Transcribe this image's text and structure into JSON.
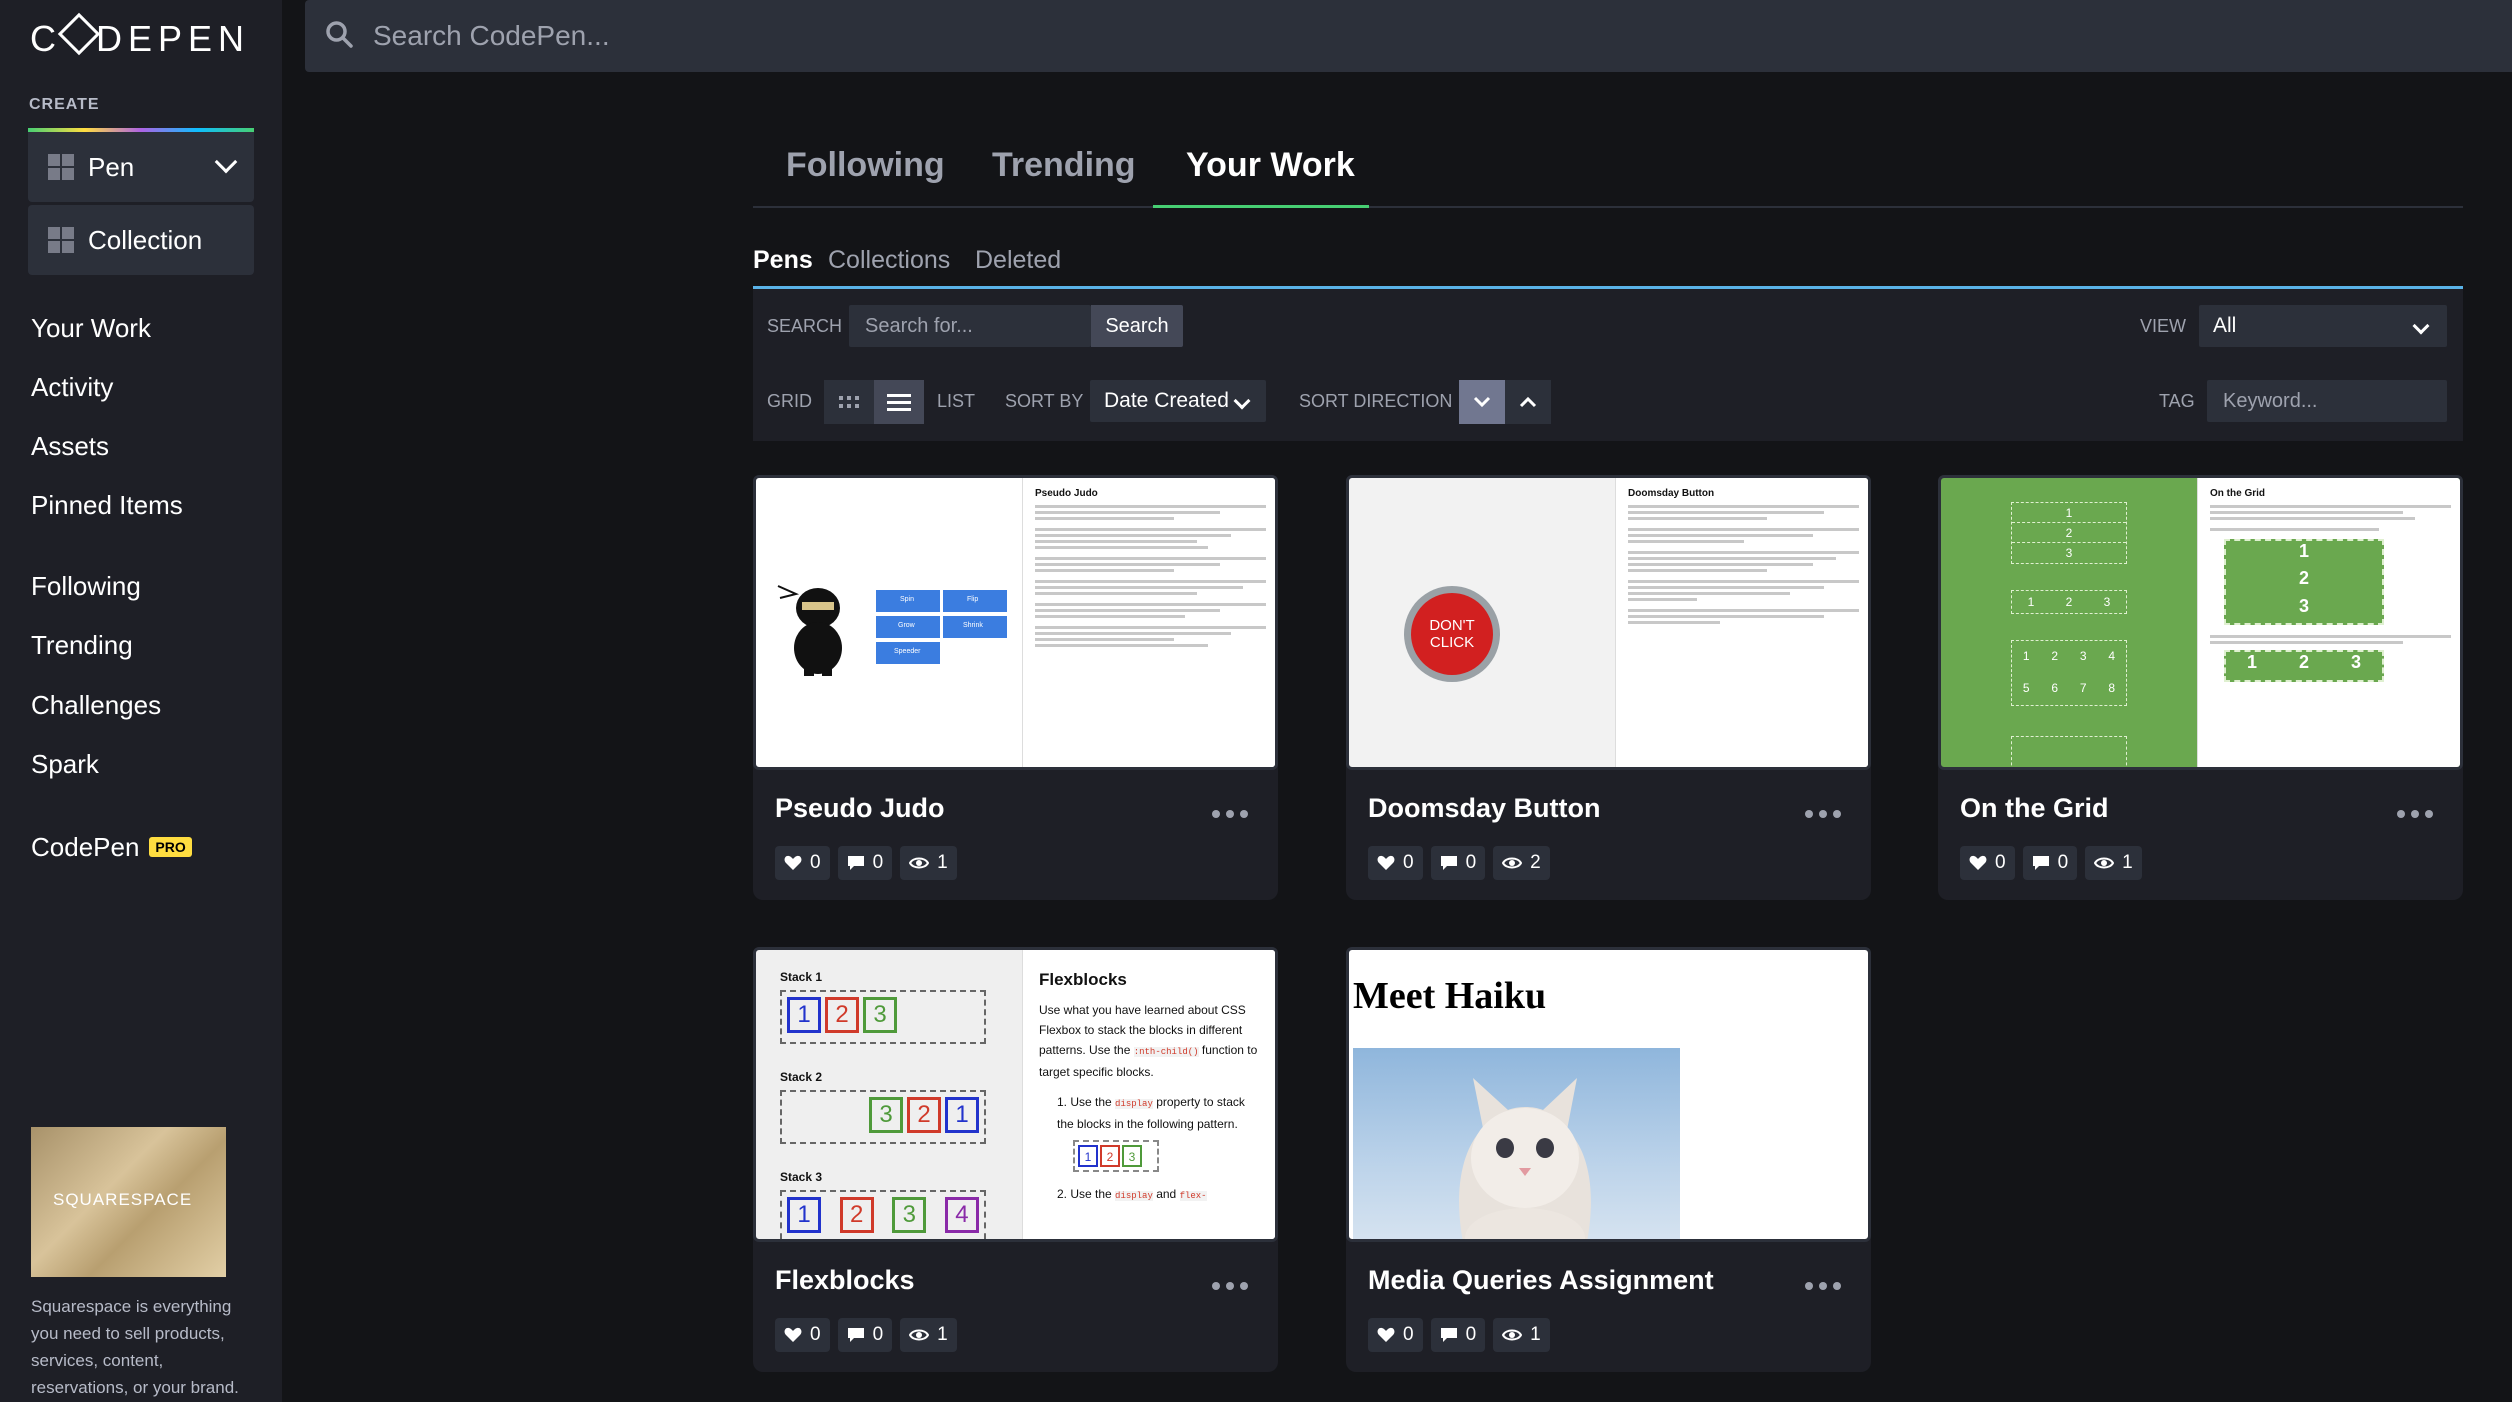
{
  "brand": {
    "logo": "CODEPEN"
  },
  "sidebar": {
    "create_label": "CREATE",
    "create_items": [
      {
        "label": "Pen"
      },
      {
        "label": "Collection"
      }
    ],
    "nav": [
      "Your Work",
      "Activity",
      "Assets",
      "Pinned Items",
      "Following",
      "Trending",
      "Challenges",
      "Spark"
    ],
    "codepen_pro": {
      "label": "CodePen",
      "badge": "PRO"
    },
    "ad": {
      "brand": "SQUARESPACE",
      "text": "Squarespace is everything you need to sell products, services, content, reservations, or your brand."
    }
  },
  "search": {
    "placeholder": "Search CodePen..."
  },
  "main_tabs": {
    "following": "Following",
    "trending": "Trending",
    "your_work": "Your Work",
    "active": "Your Work"
  },
  "sub_tabs": {
    "pens": "Pens",
    "collections": "Collections",
    "deleted": "Deleted",
    "active": "Pens"
  },
  "filters": {
    "search_label": "SEARCH",
    "search_placeholder": "Search for...",
    "search_button": "Search",
    "view_label": "VIEW",
    "view_value": "All",
    "grid_label": "GRID",
    "list_label": "LIST",
    "view_mode": "list",
    "sort_by_label": "SORT BY",
    "sort_by_value": "Date Created",
    "sort_direction_label": "SORT DIRECTION",
    "sort_direction": "descending",
    "tag_label": "TAG",
    "tag_placeholder": "Keyword..."
  },
  "pens": [
    {
      "title": "Pseudo Judo",
      "likes": "0",
      "comments": "0",
      "views": "1",
      "thumb": {
        "heading": "Pseudo Judo",
        "buttons": [
          "Spin",
          "Flip",
          "Grow",
          "Shrink",
          "Speeder"
        ]
      }
    },
    {
      "title": "Doomsday Button",
      "likes": "0",
      "comments": "0",
      "views": "2",
      "thumb": {
        "heading": "Doomsday Button",
        "button": "DON'T CLICK"
      }
    },
    {
      "title": "On the Grid",
      "likes": "0",
      "comments": "0",
      "views": "1",
      "thumb": {
        "heading": "On the Grid",
        "nums_a": [
          "1",
          "2",
          "3"
        ],
        "nums_b": [
          "1",
          "2",
          "3",
          "4",
          "5",
          "6",
          "7",
          "8"
        ]
      }
    },
    {
      "title": "Flexblocks",
      "likes": "0",
      "comments": "0",
      "views": "1",
      "thumb": {
        "heading": "Flexblocks",
        "stack1": "Stack 1",
        "stack2": "Stack 2",
        "stack3": "Stack 3",
        "s1": [
          "1",
          "2",
          "3"
        ],
        "s2": [
          "3",
          "2",
          "1"
        ],
        "s3": [
          "1",
          "2",
          "3",
          "4"
        ],
        "p1": "Use what you have learned about CSS Flexbox to stack the blocks in different patterns. Use the",
        "code1": ":nth-child()",
        "p1b": "function to target specific blocks.",
        "li1a": "1. Use the",
        "code2": "display",
        "li1b": "property to stack the blocks in the following pattern.",
        "li2a": "2. Use the",
        "code3": "display",
        "li2b": "and",
        "code4": "flex-"
      }
    },
    {
      "title": "Media Queries Assignment",
      "likes": "0",
      "comments": "0",
      "views": "1",
      "thumb": {
        "heading": "Meet Haiku"
      }
    }
  ],
  "colors": {
    "accent": "#47cf73",
    "bg": "#131417",
    "panel": "#1e1f26",
    "control": "#2c303a",
    "pro": "#ffdd40",
    "subtab_line": "#5ab3e8"
  }
}
